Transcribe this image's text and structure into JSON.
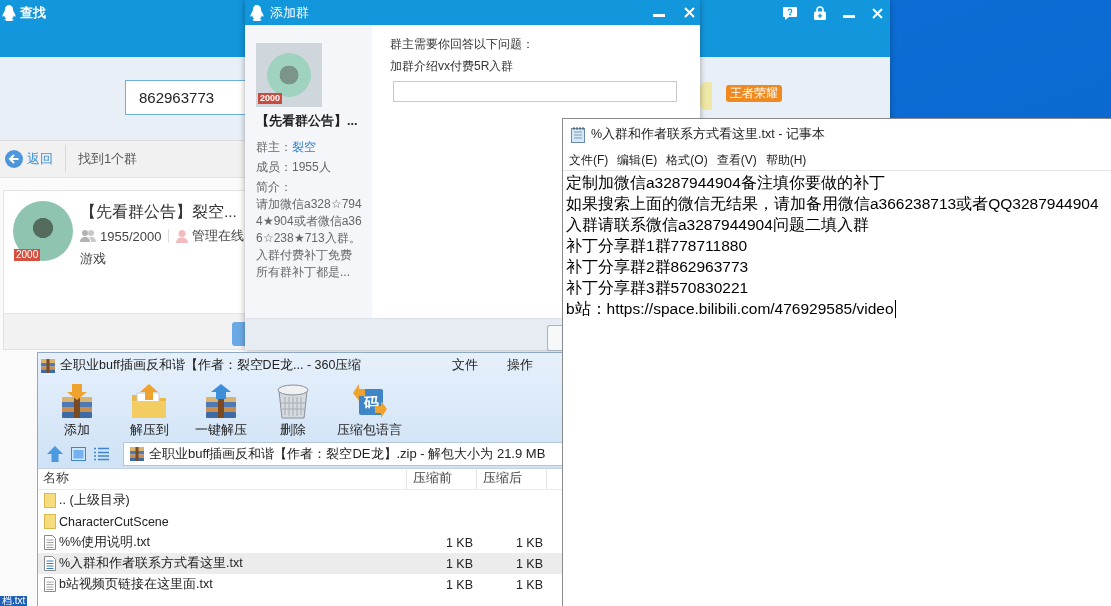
{
  "desktop": {
    "file_label": "档.txt"
  },
  "find_window": {
    "title": "查找",
    "search": {
      "value": "862963773"
    },
    "game_tag": "王者荣耀",
    "back": "返回",
    "result_count": "找到1个群",
    "group": {
      "name": "【先看群公告】裂空...",
      "badge": "2000",
      "members": "1955/2000",
      "admin_status": "管理在线",
      "category": "游戏"
    }
  },
  "add_group_dialog": {
    "title": "添加群",
    "group": {
      "name": "【先看群公告】...",
      "badge": "2000",
      "owner_label": "群主：",
      "owner": "裂空",
      "members": "成员：1955人",
      "intro_label": "简介：",
      "intro": "请加微信a328☆7944★904或者微信a366☆238★713入群。入群付费补丁免费所有群补丁都是..."
    },
    "question_prompt": "群主需要你回答以下问题：",
    "question": "加群介绍vx付费5R入群"
  },
  "notepad": {
    "title": "%入群和作者联系方式看这里.txt - 记事本",
    "menu": [
      "文件(F)",
      "编辑(E)",
      "格式(O)",
      "查看(V)",
      "帮助(H)"
    ],
    "lines": [
      "定制加微信a3287944904备注填你要做的补丁",
      "如果搜索上面的微信无结果，请加备用微信a366238713或者QQ3287944904",
      "入群请联系微信a3287944904问题二填入群",
      "补丁分享群1群778711880",
      "补丁分享群2群862963773",
      "补丁分享群3群570830221",
      "b站：https://space.bilibili.com/476929585/video"
    ]
  },
  "zip_window": {
    "title": "全职业buff插画反和谐【作者：裂空DE龙... - 360压缩",
    "menu": [
      "文件",
      "操作"
    ],
    "toolbar": [
      {
        "kind": "add",
        "label": "添加"
      },
      {
        "kind": "extract_to",
        "label": "解压到"
      },
      {
        "kind": "quick_extract",
        "label": "一键解压"
      },
      {
        "kind": "delete",
        "label": "删除"
      },
      {
        "kind": "language",
        "label": "压缩包语言",
        "icon_text": "码"
      }
    ],
    "path": "全职业buff插画反和谐【作者：裂空DE龙】.zip - 解包大小为 21.9 MB",
    "columns": [
      "名称",
      "压缩前",
      "压缩后"
    ],
    "files": [
      {
        "name": ".. (上级目录)",
        "kind": "folder",
        "selected": false
      },
      {
        "name": "CharacterCutScene",
        "kind": "folder",
        "selected": false
      },
      {
        "name": "%%使用说明.txt",
        "kind": "text",
        "size": "1 KB",
        "packed_size": "1 KB",
        "selected": false
      },
      {
        "name": "%入群和作者联系方式看这里.txt",
        "kind": "text",
        "size": "1 KB",
        "packed_size": "1 KB",
        "selected": true
      },
      {
        "name": "b站视频页链接在这里面.txt",
        "kind": "text",
        "size": "1 KB",
        "packed_size": "1 KB",
        "selected": false
      }
    ]
  }
}
